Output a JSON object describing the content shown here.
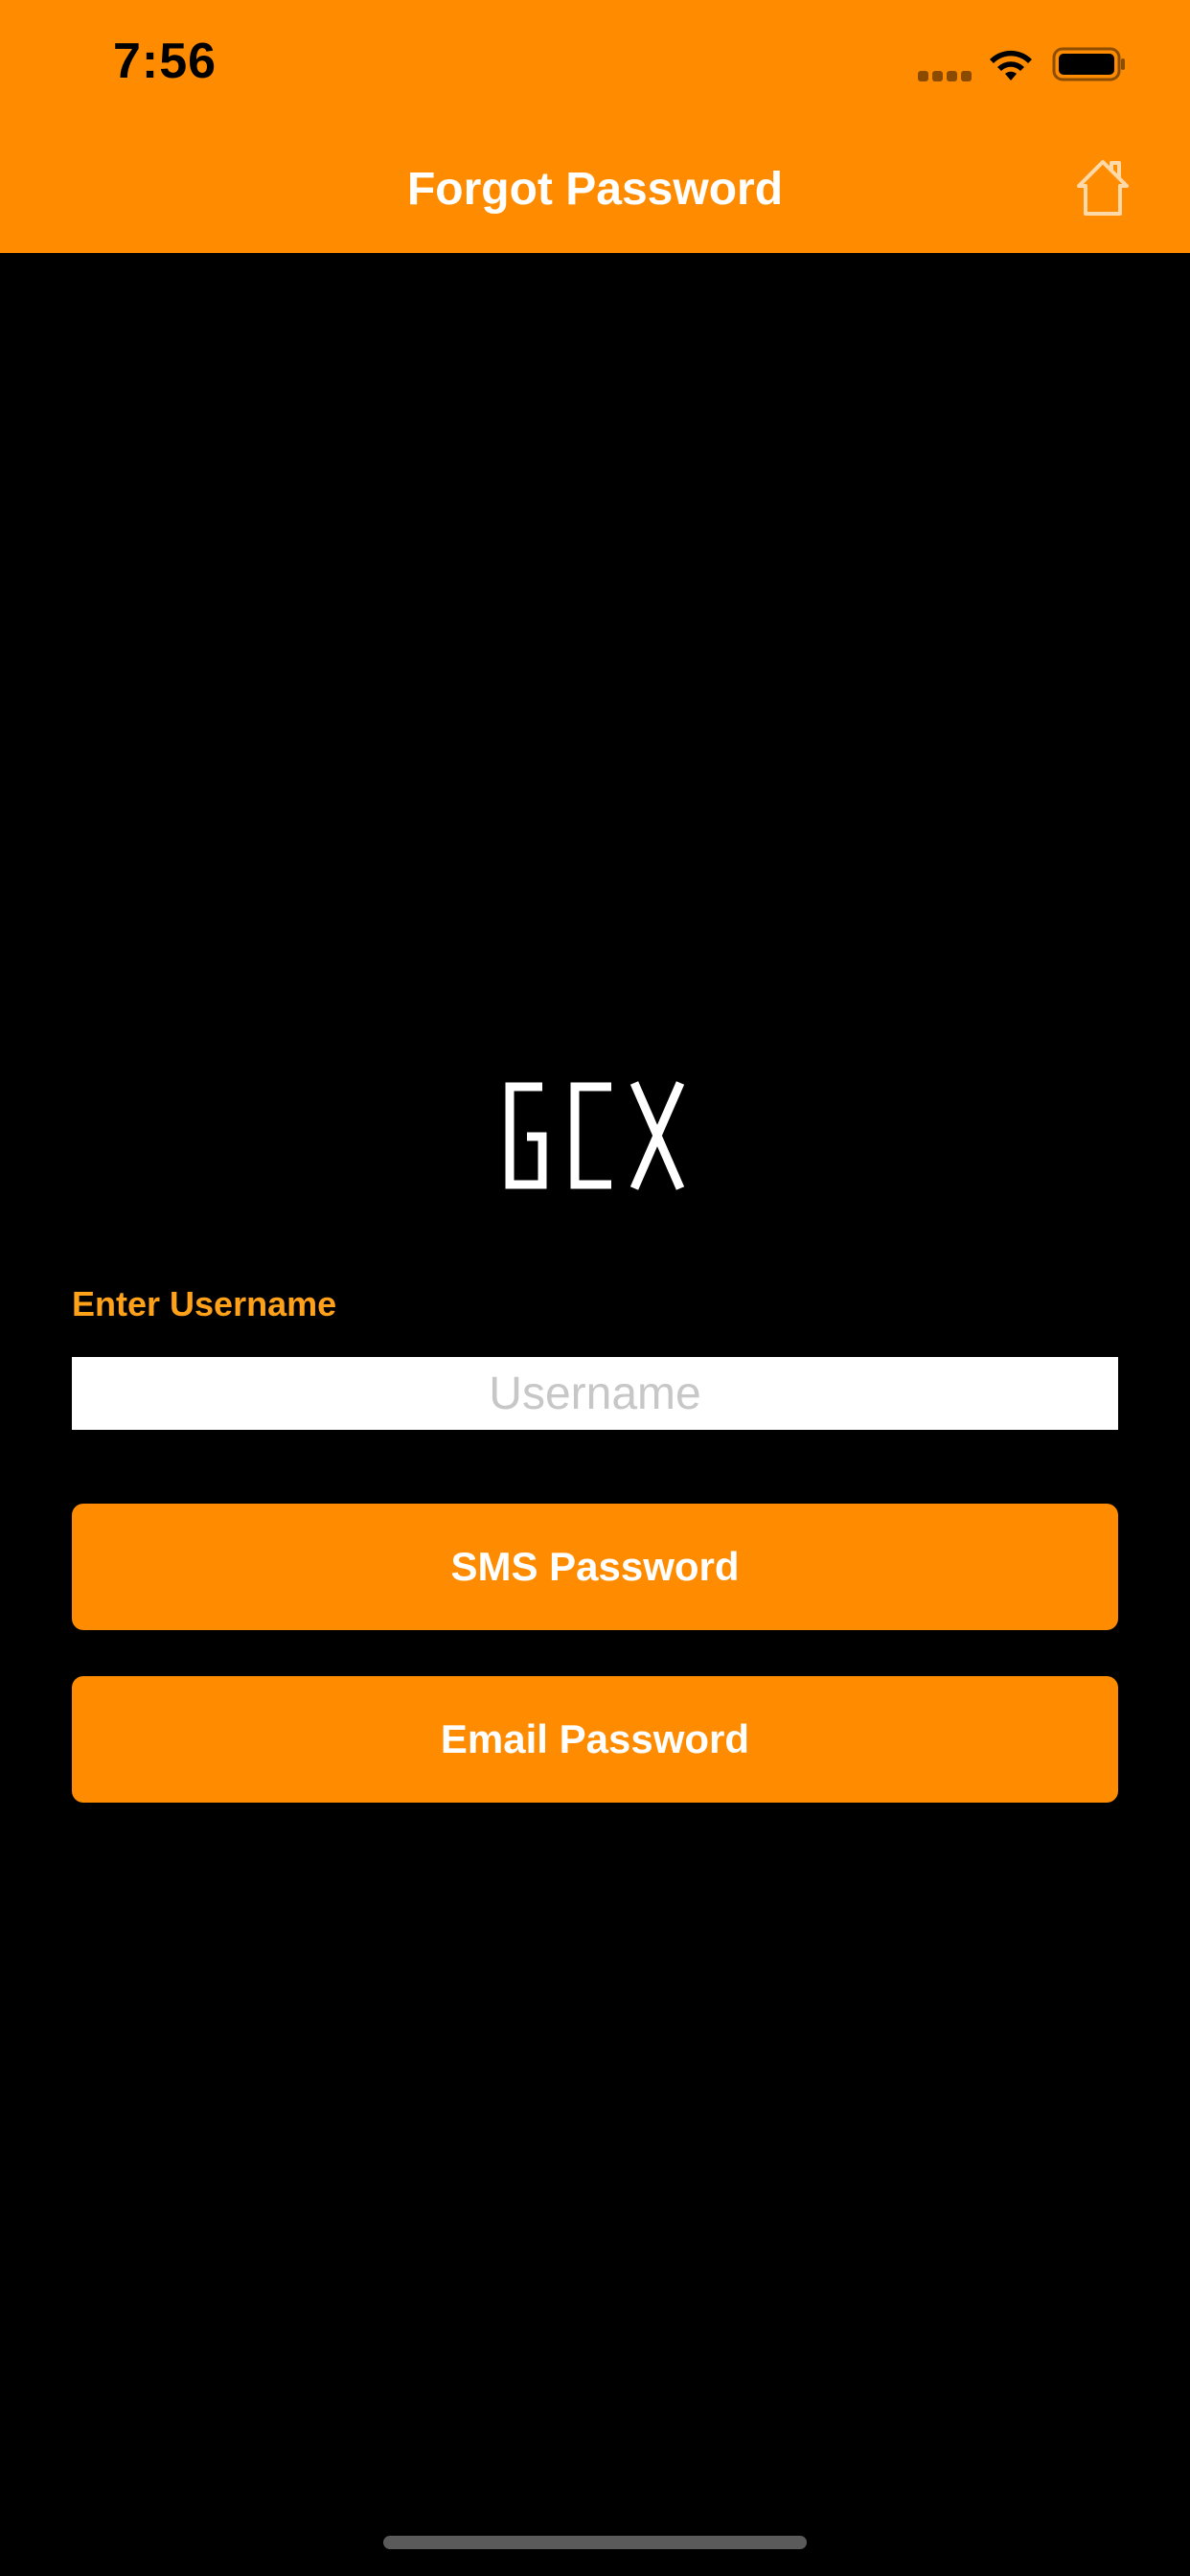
{
  "status_bar": {
    "time": "7:56",
    "icons": [
      "signal-icon",
      "wifi-icon",
      "battery-icon"
    ]
  },
  "header": {
    "title": "Forgot Password",
    "home_icon": "home-icon"
  },
  "logo": {
    "text": "GCX"
  },
  "form": {
    "username_label": "Enter Username",
    "username_value": "",
    "username_placeholder": "Username"
  },
  "buttons": {
    "sms_label": "SMS Password",
    "email_label": "Email Password"
  },
  "colors": {
    "accent": "#FF8C00",
    "label": "#FFA21A",
    "background": "#000000"
  }
}
